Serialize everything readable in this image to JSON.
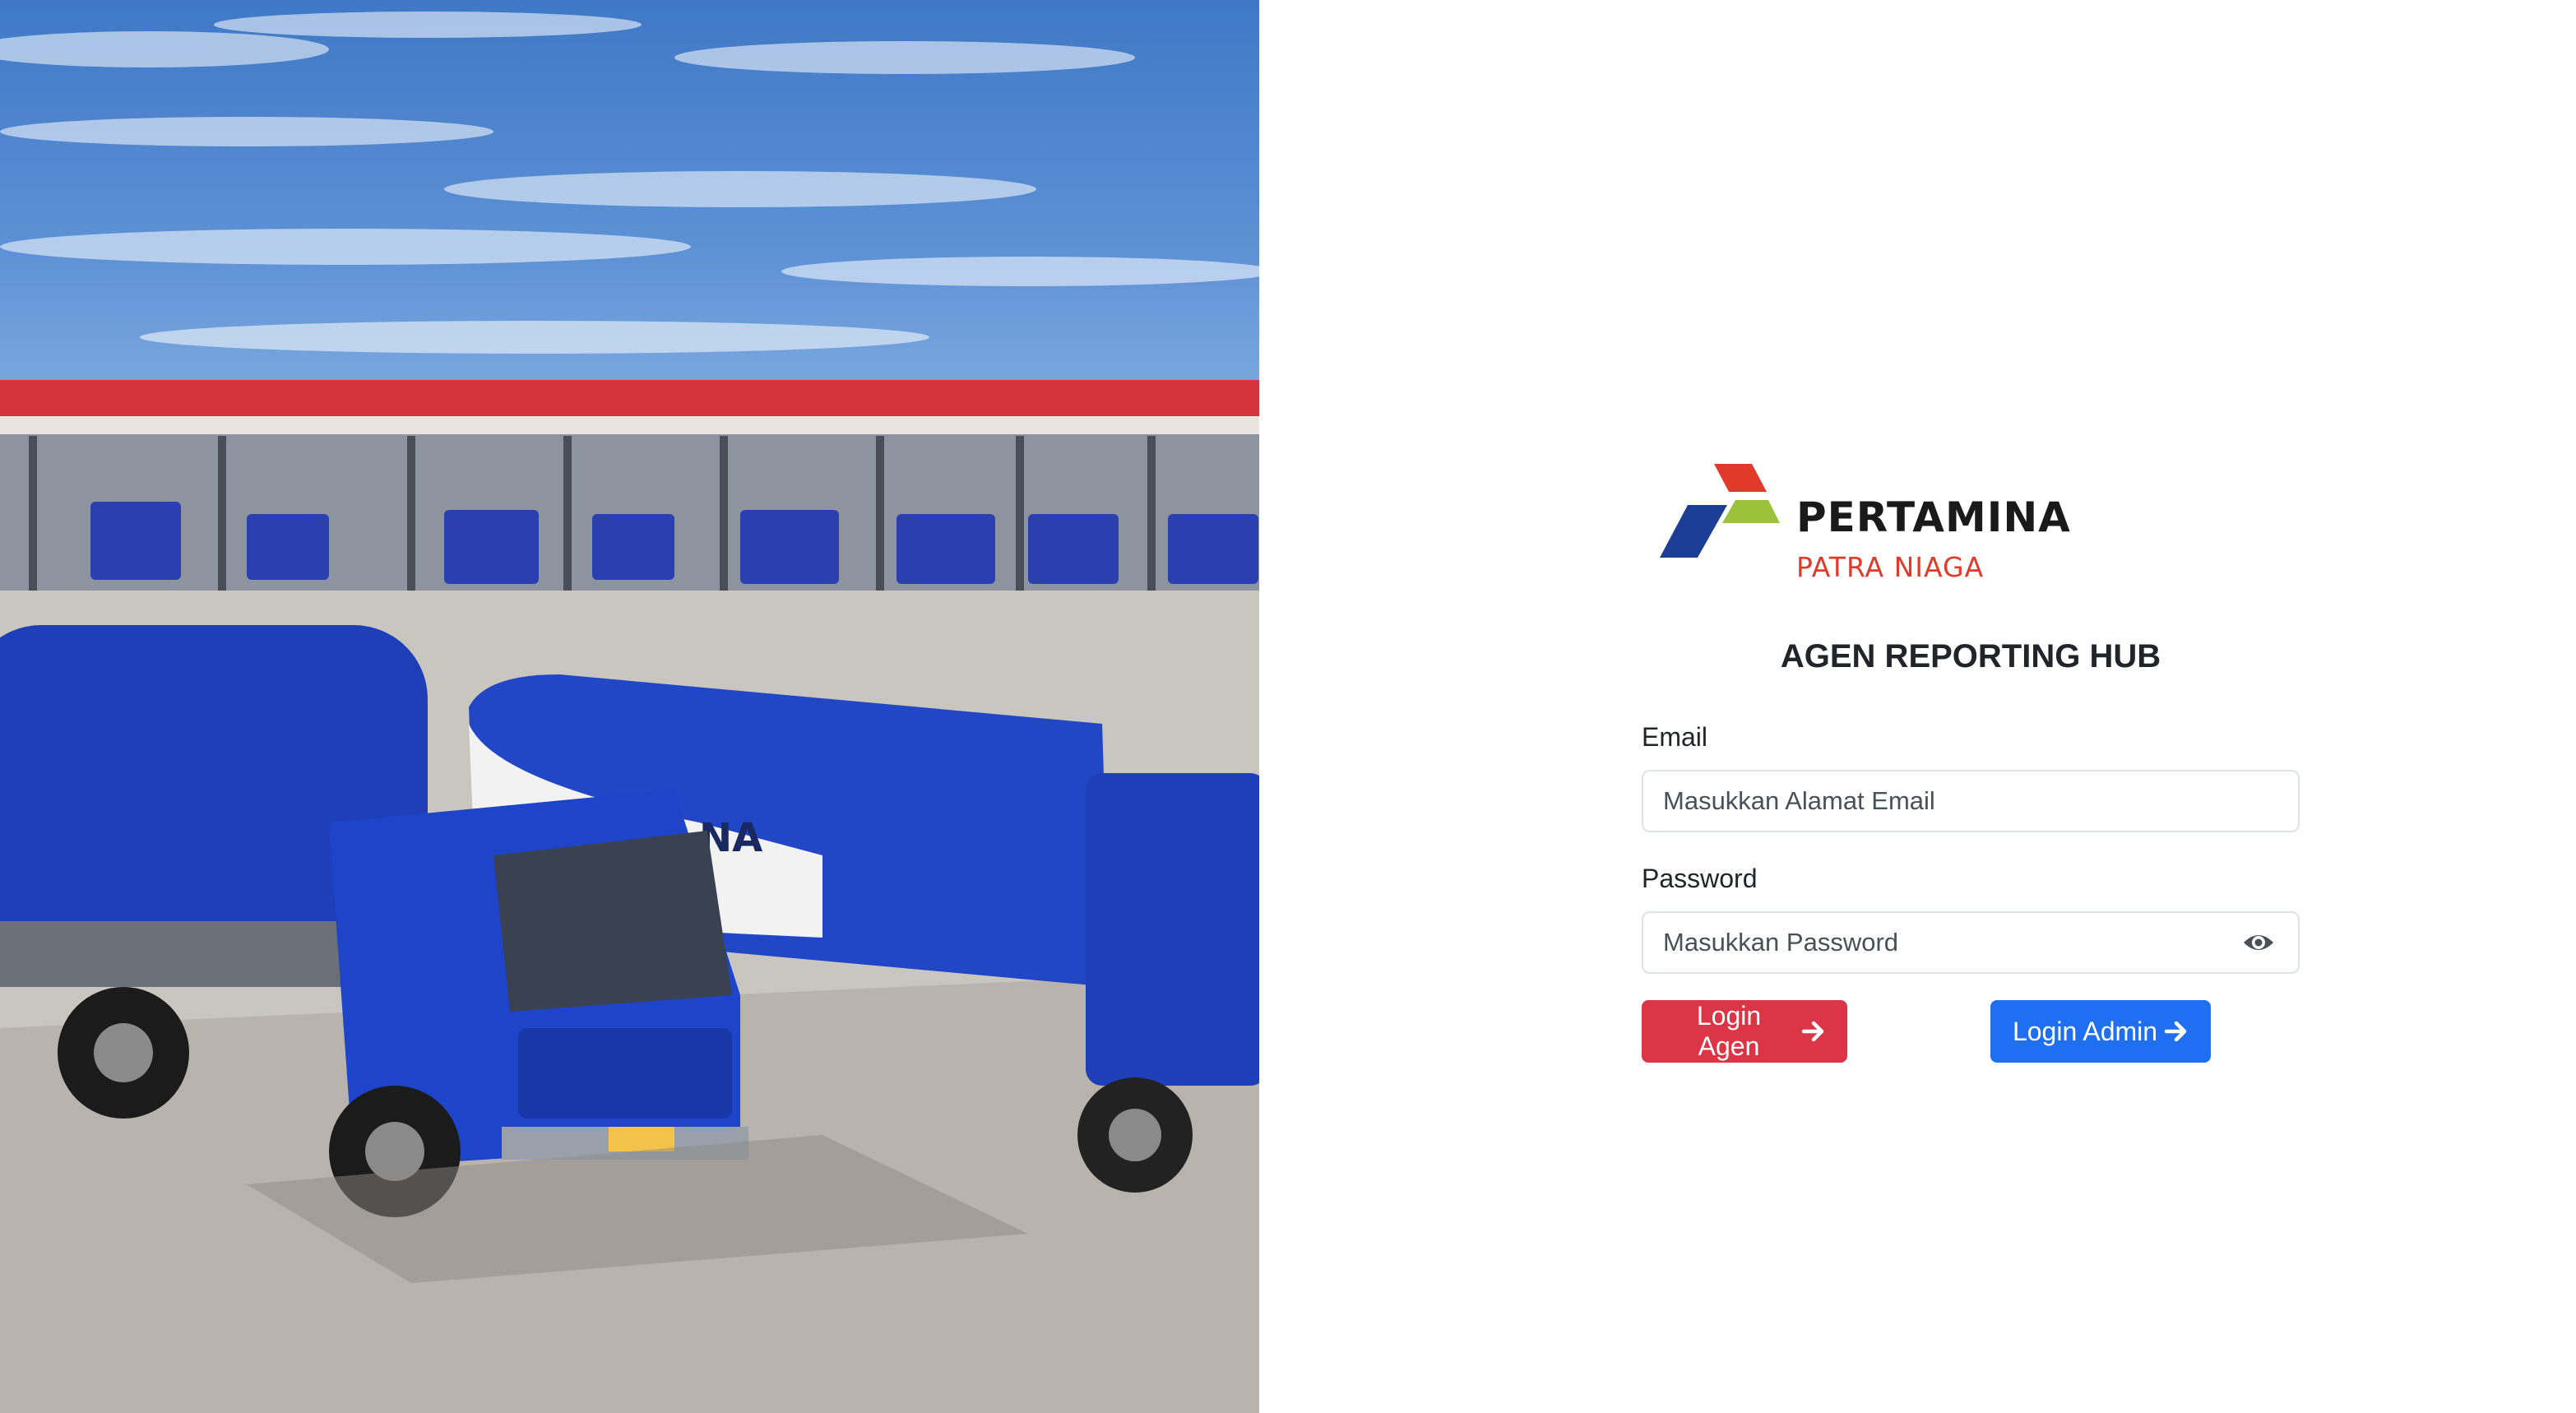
{
  "hero": {
    "description_icon": "fuel-tanker-photo",
    "tanker_lettering": [
      "NA"
    ]
  },
  "logo": {
    "icon": "pertamina-logo-icon",
    "brand": "PERTAMINA",
    "subbrand": "PATRA NIAGA",
    "colors": {
      "red": "#e03a2b",
      "green": "#9cc13b",
      "blue": "#1d3e97"
    }
  },
  "app_title": "AGEN REPORTING HUB",
  "form": {
    "email_label": "Email",
    "email_placeholder": "Masukkan Alamat Email",
    "email_value": "",
    "password_label": "Password",
    "password_placeholder": "Masukkan Password",
    "password_value": "",
    "password_toggle_icon": "eye-icon"
  },
  "buttons": {
    "agen_label": "Login Agen",
    "admin_label": "Login Admin",
    "arrow_icon": "arrow-right-icon",
    "agen_color": "#dc3545",
    "admin_color": "#1f6ff2"
  }
}
